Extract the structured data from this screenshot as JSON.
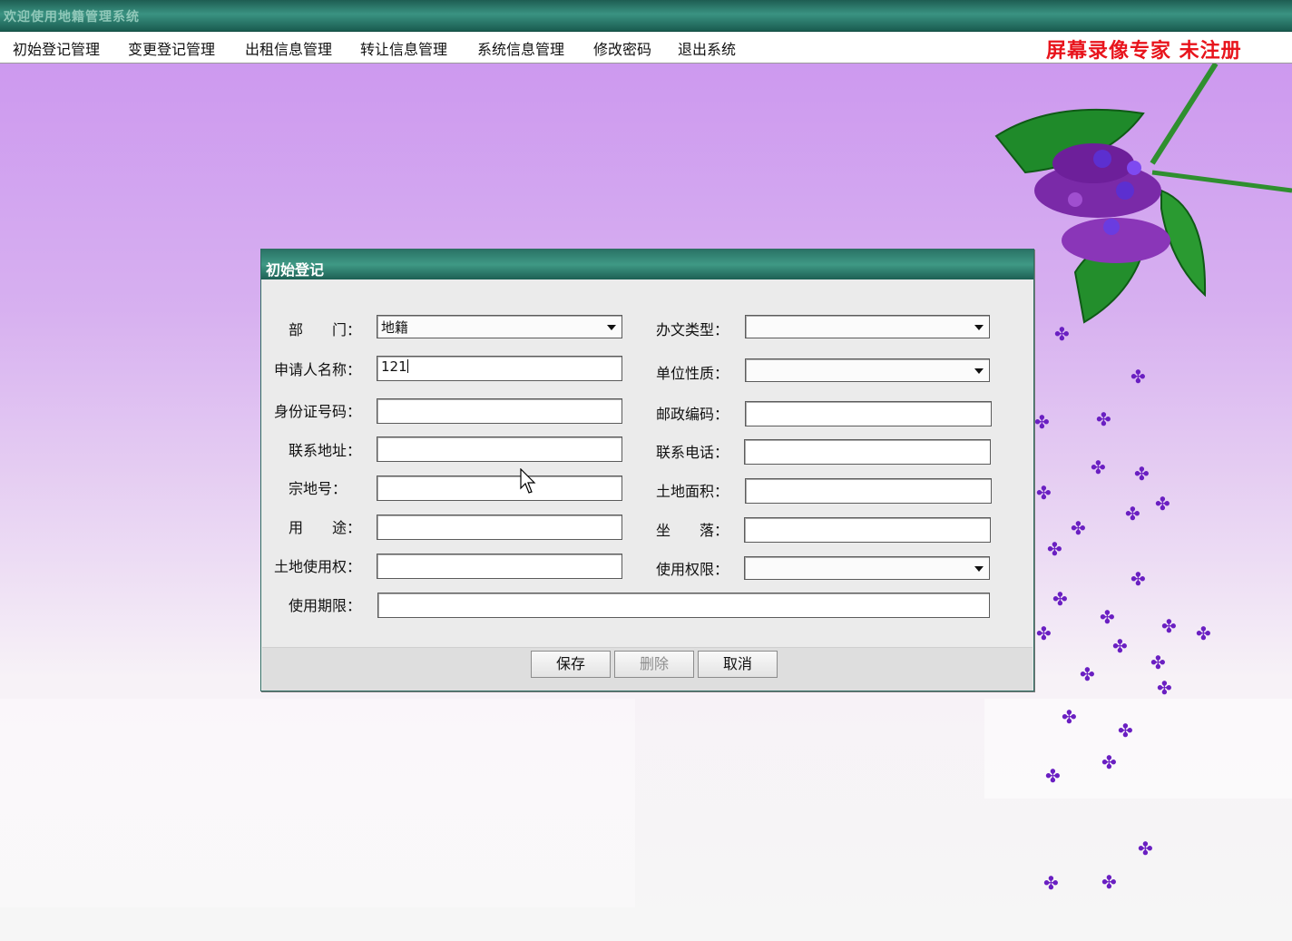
{
  "window": {
    "title": "欢迎使用地籍管理系统"
  },
  "menu": {
    "items": [
      {
        "label": "初始登记管理"
      },
      {
        "label": "变更登记管理"
      },
      {
        "label": "出租信息管理"
      },
      {
        "label": "转让信息管理"
      },
      {
        "label": "系统信息管理"
      },
      {
        "label": "修改密码"
      },
      {
        "label": "退出系统"
      }
    ],
    "watermark": "屏幕录像专家  未注册"
  },
  "dialog": {
    "title": "初始登记",
    "labels": {
      "department": "部　　门：",
      "doc_type": "办文类型：",
      "applicant": "申请人名称：",
      "unit_nature": "单位性质：",
      "id_number": "身份证号码：",
      "postal_code": "邮政编码：",
      "address": "联系地址：",
      "phone": "联系电话：",
      "parcel_no": "宗地号：",
      "land_area": "土地面积：",
      "usage": "用　　途：",
      "location": "坐　　落：",
      "land_use_right": "土地使用权：",
      "use_authority": "使用权限：",
      "use_period": "使用期限："
    },
    "values": {
      "department": "地籍",
      "doc_type": "",
      "applicant": "121",
      "unit_nature": "",
      "id_number": "",
      "postal_code": "",
      "address": "",
      "phone": "",
      "parcel_no": "",
      "land_area": "",
      "usage": "",
      "location": "",
      "land_use_right": "",
      "use_authority": "",
      "use_period": ""
    },
    "buttons": {
      "save": "保存",
      "delete": "删除",
      "cancel": "取消"
    }
  },
  "colors": {
    "titlebar": "#3a9382",
    "watermark": "#e8141c",
    "flower": "#6a1fc2"
  }
}
